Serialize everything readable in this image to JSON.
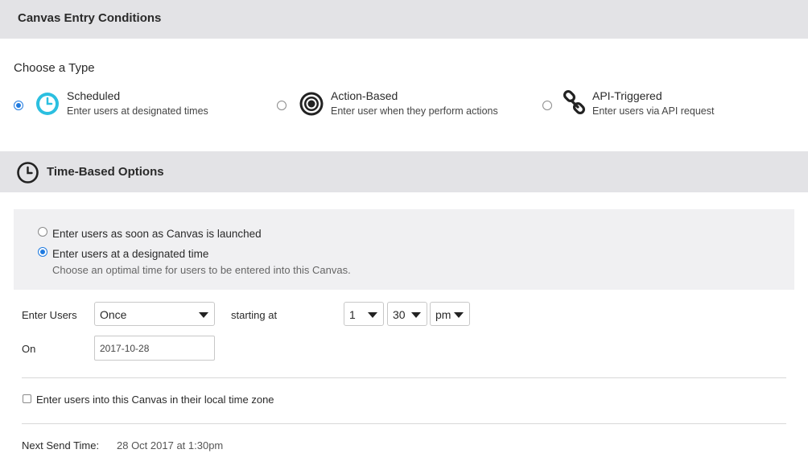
{
  "header": {
    "title": "Canvas Entry Conditions"
  },
  "type_section": {
    "heading": "Choose a Type",
    "types": [
      {
        "label": "Scheduled",
        "description": "Enter users at designated times",
        "icon": "clock-icon",
        "selected": true
      },
      {
        "label": "Action-Based",
        "description": "Enter user when they perform actions",
        "icon": "target-icon",
        "selected": false
      },
      {
        "label": "API-Triggered",
        "description": "Enter users via API request",
        "icon": "link-icon",
        "selected": false
      }
    ]
  },
  "time_section": {
    "title": "Time-Based Options",
    "icon": "clock-icon",
    "options": [
      {
        "label": "Enter users as soon as Canvas is launched",
        "selected": false
      },
      {
        "label": "Enter users at a designated time",
        "selected": true,
        "hint": "Choose an optimal time for users to be entered into this Canvas."
      }
    ]
  },
  "form": {
    "enter_users_label": "Enter Users",
    "frequency_value": "Once",
    "starting_at_label": "starting at",
    "hour_value": "1",
    "minute_value": "30",
    "ampm_value": "pm",
    "on_label": "On",
    "date_value": "2017-10-28",
    "local_timezone_label": "Enter users into this Canvas in their local time zone",
    "local_timezone_checked": false,
    "next_send_label": "Next Send Time:",
    "next_send_value": "28 Oct 2017 at 1:30pm"
  },
  "colors": {
    "accent": "#1f7ae0",
    "scheduled_icon": "#2bbfe0",
    "header_bg": "#e3e3e6",
    "panel_bg": "#f0f0f2"
  }
}
